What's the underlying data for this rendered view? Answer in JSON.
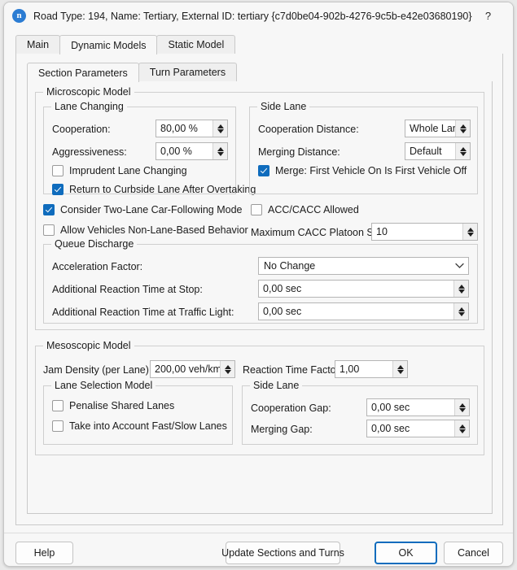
{
  "window": {
    "title": "Road Type: 194, Name: Tertiary, External ID: tertiary  {c7d0be04-902b-4276-9c5b-e42e03680190}",
    "app_icon_glyph": "n",
    "help_glyph": "?",
    "close_glyph": "✕",
    "accent_color": "#0f6cbd"
  },
  "tabs": {
    "outer": [
      {
        "label": "Main",
        "active": false
      },
      {
        "label": "Dynamic Models",
        "active": true
      },
      {
        "label": "Static Model",
        "active": false
      }
    ],
    "inner": [
      {
        "label": "Section Parameters",
        "active": true
      },
      {
        "label": "Turn Parameters",
        "active": false
      }
    ]
  },
  "microscopic": {
    "title": "Microscopic Model",
    "lane_changing": {
      "title": "Lane Changing",
      "cooperation_label": "Cooperation:",
      "cooperation_value": "80,00 %",
      "aggressiveness_label": "Aggressiveness:",
      "aggressiveness_value": "0,00 %",
      "imprudent_label": "Imprudent Lane Changing",
      "imprudent_checked": false,
      "return_curbside_label": "Return to Curbside Lane After Overtaking",
      "return_curbside_checked": true
    },
    "side_lane": {
      "title": "Side Lane",
      "cooperation_distance_label": "Cooperation Distance:",
      "cooperation_distance_value": "Whole Lane",
      "merging_distance_label": "Merging Distance:",
      "merging_distance_value": "Default",
      "merge_first_label": "Merge: First Vehicle On Is First Vehicle Off",
      "merge_first_checked": true
    },
    "two_lane_label": "Consider Two-Lane Car-Following Mode",
    "two_lane_checked": true,
    "non_lane_based_label": "Allow Vehicles Non-Lane-Based Behavior",
    "non_lane_based_checked": false,
    "acc_cacc_label": "ACC/CACC Allowed",
    "acc_cacc_checked": false,
    "max_platoon_label": "Maximum CACC Platoon Size:",
    "max_platoon_value": "10",
    "queue_discharge": {
      "title": "Queue Discharge",
      "accel_factor_label": "Acceleration Factor:",
      "accel_factor_value": "No Change",
      "reaction_stop_label": "Additional Reaction Time at Stop:",
      "reaction_stop_value": "0,00 sec",
      "reaction_light_label": "Additional Reaction Time at Traffic Light:",
      "reaction_light_value": "0,00 sec"
    }
  },
  "mesoscopic": {
    "title": "Mesoscopic Model",
    "jam_density_label": "Jam Density (per Lane):",
    "jam_density_value": "200,00 veh/km",
    "reaction_factor_label": "Reaction Time Factor:",
    "reaction_factor_value": "1,00",
    "lane_selection": {
      "title": "Lane Selection Model",
      "penalise_label": "Penalise Shared Lanes",
      "penalise_checked": false,
      "fast_slow_label": "Take into Account Fast/Slow Lanes",
      "fast_slow_checked": false
    },
    "side_lane": {
      "title": "Side Lane",
      "cooperation_gap_label": "Cooperation Gap:",
      "cooperation_gap_value": "0,00 sec",
      "merging_gap_label": "Merging Gap:",
      "merging_gap_value": "0,00 sec"
    }
  },
  "footer": {
    "help": "Help",
    "update": "Update Sections and Turns",
    "ok": "OK",
    "cancel": "Cancel"
  }
}
